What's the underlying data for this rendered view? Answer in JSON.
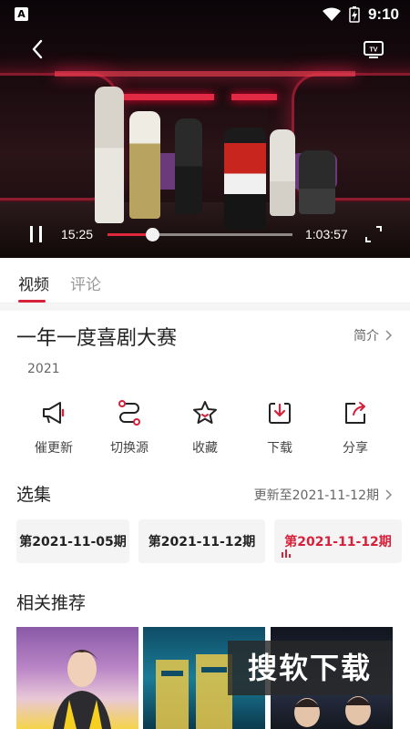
{
  "status_bar": {
    "app_badge": "A",
    "time": "9:10"
  },
  "player": {
    "current_time": "15:25",
    "total_time": "1:03:57",
    "progress_fraction": 0.241,
    "accent_color": "#e0283c"
  },
  "tabs": [
    {
      "label": "视频",
      "active": true
    },
    {
      "label": "评论",
      "active": false
    }
  ],
  "show": {
    "title": "一年一度喜剧大赛",
    "intro_link": "简介",
    "year": "2021"
  },
  "actions": [
    {
      "label": "催更新",
      "icon": "megaphone-icon"
    },
    {
      "label": "切换源",
      "icon": "switch-source-icon"
    },
    {
      "label": "收藏",
      "icon": "star-icon"
    },
    {
      "label": "下载",
      "icon": "download-icon"
    },
    {
      "label": "分享",
      "icon": "share-icon"
    }
  ],
  "episodes": {
    "title": "选集",
    "update_info": "更新至2021-11-12期",
    "items": [
      {
        "label": "第2021-11-05期",
        "active": false
      },
      {
        "label": "第2021-11-12期",
        "active": false
      },
      {
        "label": "第2021-11-12期",
        "active": true
      }
    ]
  },
  "recommendations": {
    "title": "相关推荐"
  },
  "watermark": "搜软下载",
  "colors": {
    "brand_red": "#d7203a",
    "muted_text": "#999999"
  }
}
